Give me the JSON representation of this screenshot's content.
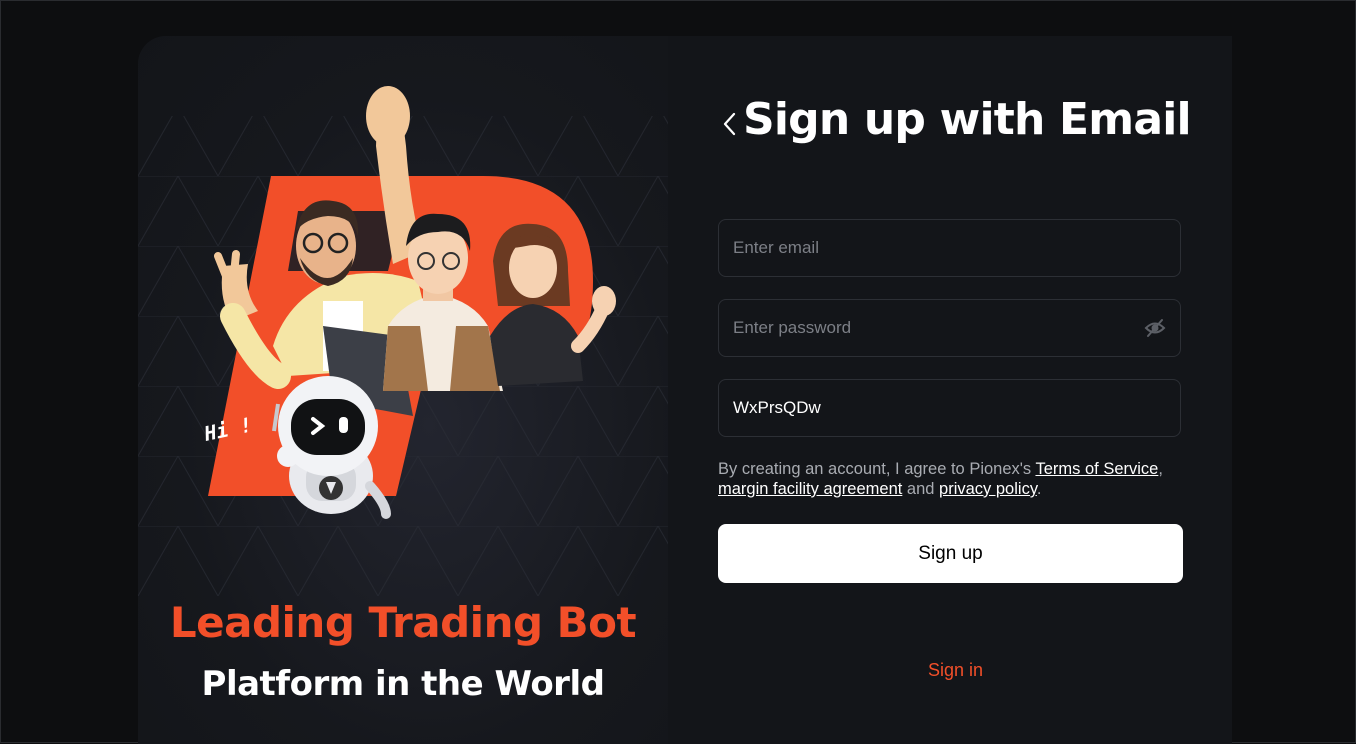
{
  "hero": {
    "title": "Leading Trading Bot",
    "subtitle": "Platform in the World",
    "greeting": "Hi !",
    "accent_color": "#f24f29"
  },
  "form": {
    "title": "Sign up with Email",
    "back_icon": "chevron-left-icon",
    "email": {
      "placeholder": "Enter email",
      "value": ""
    },
    "password": {
      "placeholder": "Enter password",
      "value": "",
      "toggle_icon": "eye-off-icon"
    },
    "referral": {
      "placeholder": "",
      "value": "WxPrsQDw"
    },
    "terms": {
      "prefix": "By creating an account, I agree to Pionex's ",
      "terms_link": "Terms of Service",
      "sep1": ", ",
      "margin_link": "margin facility agreement",
      "sep2": " and ",
      "privacy_link": "privacy policy",
      "suffix": "."
    },
    "signup_label": "Sign up",
    "signin_label": "Sign in"
  }
}
